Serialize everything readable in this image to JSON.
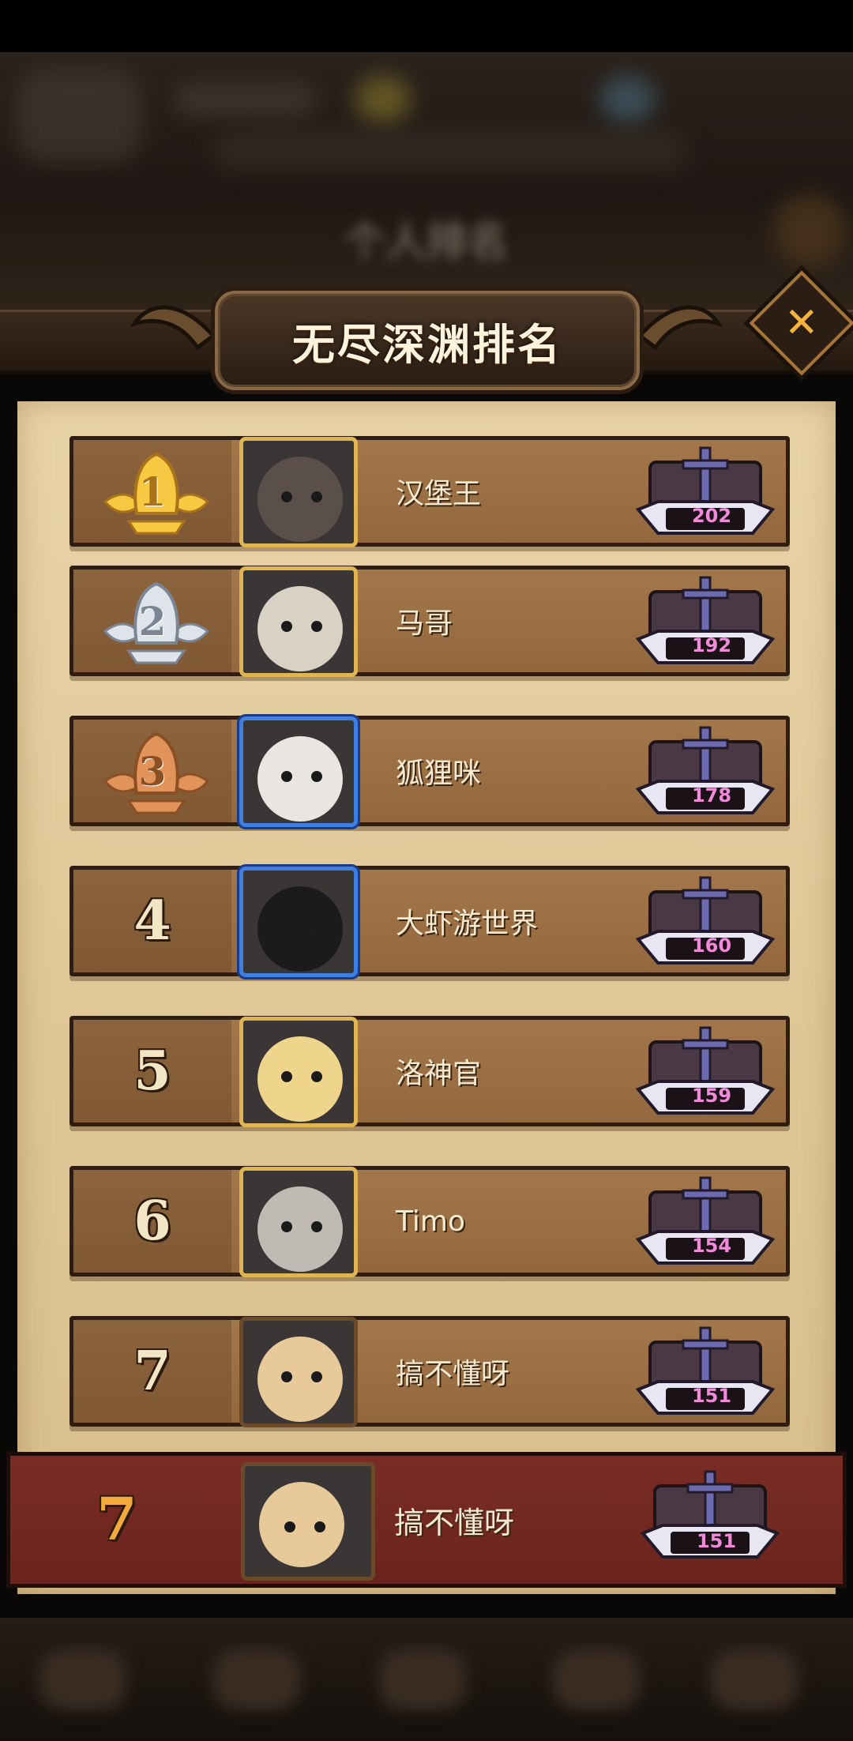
{
  "header": {
    "title": "无尽深渊排名",
    "close_icon": "close-icon"
  },
  "background_title": "个人排名",
  "rows": [
    {
      "rank": "1",
      "rank_style": "gold-medal",
      "name": "汉堡王",
      "score": "202",
      "frame": "gold"
    },
    {
      "rank": "2",
      "rank_style": "silver-medal",
      "name": "马哥",
      "score": "192",
      "frame": "gold"
    },
    {
      "rank": "3",
      "rank_style": "bronze-medal",
      "name": "狐狸咪",
      "score": "178",
      "frame": "blue"
    },
    {
      "rank": "4",
      "rank_style": "number",
      "name": "大虾游世界",
      "score": "160",
      "frame": "blue"
    },
    {
      "rank": "5",
      "rank_style": "number",
      "name": "洛神官",
      "score": "159",
      "frame": "gold"
    },
    {
      "rank": "6",
      "rank_style": "number",
      "name": "Timo",
      "score": "154",
      "frame": "gold"
    },
    {
      "rank": "7",
      "rank_style": "number",
      "name": "搞不懂呀",
      "score": "151",
      "frame": "bronze"
    }
  ],
  "self_row": {
    "rank": "7",
    "name": "搞不懂呀",
    "score": "151"
  },
  "colors": {
    "self_row": "#7a2c24",
    "row": "#9a6e43",
    "parchment": "#e6cfa0",
    "score": "#f18ad8"
  }
}
